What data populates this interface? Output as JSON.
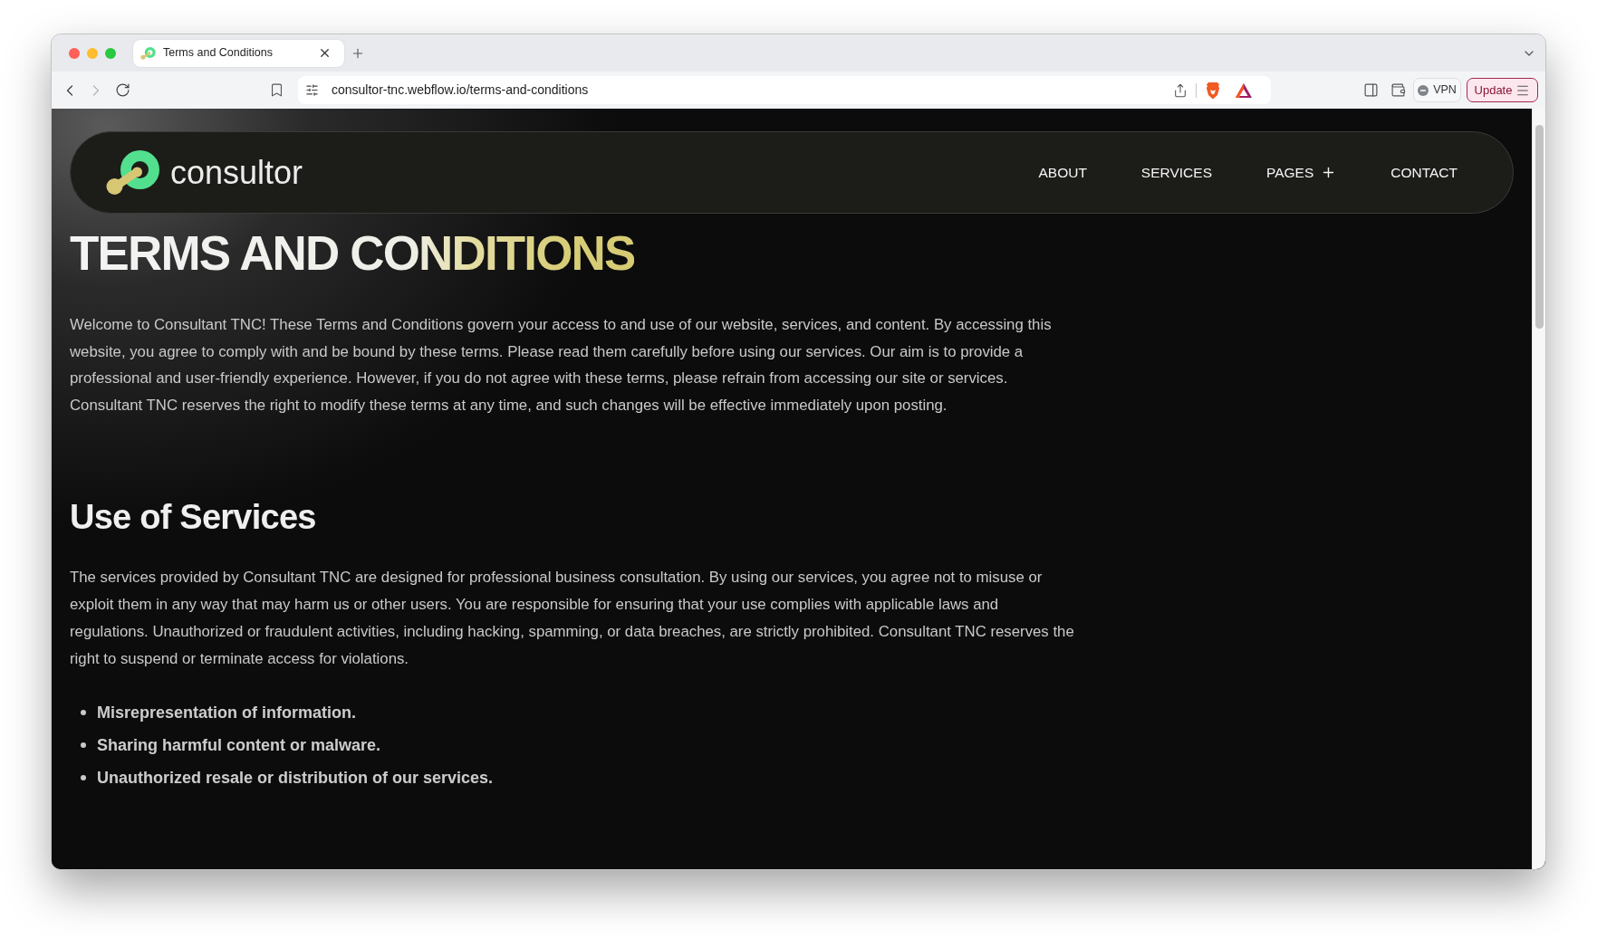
{
  "browser": {
    "tabs": [
      {
        "title": "Terms and Conditions",
        "selected": true
      }
    ],
    "back": {
      "disabled": false
    },
    "forward": {
      "disabled": true
    },
    "url": "consultor-tnc.webflow.io/terms-and-conditions",
    "vpn": {
      "label": "VPN",
      "connected": false
    },
    "update_button": {
      "label": "Update"
    }
  },
  "site": {
    "logo": {
      "text": "consultor"
    },
    "nav": [
      {
        "label": "ABOUT",
        "kind": "link"
      },
      {
        "label": "SERVICES",
        "kind": "link"
      },
      {
        "label": "PAGES",
        "kind": "dropdown"
      },
      {
        "label": "CONTACT",
        "kind": "link"
      }
    ],
    "title": "TERMS AND CONDITIONS",
    "intro": "Welcome to Consultant TNC! These Terms and Conditions govern your access to and use of our website, services, and content. By accessing this website, you agree to comply with and be bound by these terms. Please read them carefully before using our services. Our aim is to provide a professional and user-friendly experience. However, if you do not agree with these terms, please refrain from accessing our site or services. Consultant TNC reserves the right to modify these terms at any time, and such changes will be effective immediately upon posting.",
    "sections": [
      {
        "heading": "Use of Services",
        "body": "The services provided by Consultant TNC are designed for professional business consultation. By using our services, you agree not to misuse or exploit them in any way that may harm us or other users. You are responsible for ensuring that your use complies with applicable laws and regulations. Unauthorized or fraudulent activities, including hacking, spamming, or data breaches, are strictly prohibited. Consultant TNC reserves the right to suspend or terminate access for violations.",
        "list": [
          "Misrepresentation of information.",
          "Sharing harmful content or malware.",
          "Unauthorized resale or distribution of our services."
        ]
      }
    ]
  }
}
